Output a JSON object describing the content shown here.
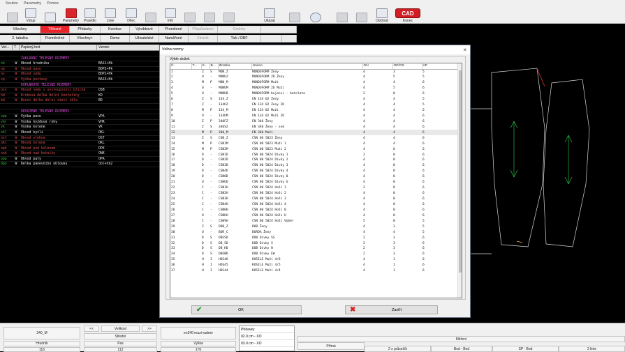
{
  "menu": [
    "Soubor",
    "Parametry",
    "Pomoc"
  ],
  "toolbar": [
    {
      "label": "",
      "icon": "grid-icon"
    },
    {
      "label": "Vstup",
      "icon": "input-icon"
    },
    {
      "label": "",
      "icon": "pattern-icon"
    },
    {
      "label": "Parametry",
      "icon": "parameters-icon"
    },
    {
      "label": "Pravidlo",
      "icon": "rule-icon"
    },
    {
      "label": "Linie",
      "icon": "line-icon"
    },
    {
      "label": "Dílec",
      "icon": "piece-icon"
    },
    {
      "label": "",
      "icon": "piece2-icon"
    },
    {
      "label": "Info",
      "icon": "printer-icon"
    },
    {
      "label": "",
      "icon": "screen-icon"
    },
    {
      "label": "",
      "icon": "document-icon"
    },
    {
      "label": "",
      "icon": "document2-icon"
    },
    {
      "label": "Ukázat",
      "icon": "show-icon"
    },
    {
      "label": "",
      "icon": "hand-icon"
    },
    {
      "label": "",
      "icon": "back-icon"
    },
    {
      "label": "",
      "icon": "save-icon"
    },
    {
      "label": "",
      "icon": "save-as-icon"
    },
    {
      "label": "Odchod",
      "icon": "exit-icon"
    },
    {
      "label": "Konec",
      "icon": "cad-logo-icon"
    }
  ],
  "tabs_row1": [
    "Všechny",
    "Tělesné",
    "Přídavky",
    "Korekce",
    "Výrobkové",
    "Proměnné",
    "Přizpůsobení",
    "Ozdoby",
    ""
  ],
  "tabs_row2": [
    "2. tabulka",
    "Pozměněné",
    "Všechny+",
    "Demo",
    "Uživatelské",
    "Naměřené",
    "Závislé",
    "Tisk / DBF",
    "",
    ""
  ],
  "attr_header": [
    "Vel...",
    "T",
    "Popisný text",
    "Vzorec"
  ],
  "attributes": [
    {
      "code": "",
      "t": "",
      "text": "",
      "formula": "",
      "style": "normal"
    },
    {
      "code": "",
      "t": "",
      "text": "ZÁKLADNÍ TĚLESNÉ ROZMĚRY",
      "formula": "",
      "style": "sec"
    },
    {
      "code": "oh",
      "t": "W",
      "text": "Obvod hrudníku",
      "formula": "BAS1+Hk",
      "style": "grn"
    },
    {
      "code": "op",
      "t": "W",
      "text": "Obvod pasu",
      "formula": "BOP2+Pk",
      "style": "red"
    },
    {
      "code": "os",
      "t": "W",
      "text": "Obvod sedu",
      "formula": "BOP2+Hk",
      "style": "red"
    },
    {
      "code": "vp",
      "t": "W",
      "text": "Výška postavy",
      "formula": "BAS3+Hk",
      "style": "red"
    },
    {
      "code": "",
      "t": "",
      "text": "DOPLŇKOVÉ TĚLESNÉ ROZMĚRY",
      "formula": "",
      "style": "sec"
    },
    {
      "code": "osv",
      "t": "W",
      "text": "Obvod sedu s vystouplostí břicha",
      "formula": "OSB",
      "style": "red"
    },
    {
      "code": "hd",
      "t": "W",
      "text": "Kroková délka dolní končetiny",
      "formula": "KD",
      "style": "red"
    },
    {
      "code": "bd",
      "t": "W",
      "text": "Boční délka dolní části těla",
      "formula": "BD",
      "style": "red"
    },
    {
      "code": "",
      "t": "",
      "text": "",
      "formula": "",
      "style": "normal"
    },
    {
      "code": "",
      "t": "",
      "text": "ODVOZENÉ TĚLESNÉ ROZMĚRY",
      "formula": "",
      "style": "sec"
    },
    {
      "code": "vpa",
      "t": "W",
      "text": "Výška pasu",
      "formula": "VPA",
      "style": "grn"
    },
    {
      "code": "vhr",
      "t": "W",
      "text": "Výška hýžďové rýhy",
      "formula": "VHR",
      "style": "grn"
    },
    {
      "code": "vk",
      "t": "W",
      "text": "Výška kolene",
      "formula": "VK",
      "style": "grn"
    },
    {
      "code": "okl",
      "t": "W",
      "text": "Obvod kyčlí",
      "formula": "OKL",
      "style": "grn"
    },
    {
      "code": "ost",
      "t": "W",
      "text": "Obvod stehna",
      "formula": "OST",
      "style": "red"
    },
    {
      "code": "okl",
      "t": "W",
      "text": "Obvod kolene",
      "formula": "OKL",
      "style": "red"
    },
    {
      "code": "opk",
      "t": "W",
      "text": "Obvod pod kolenem",
      "formula": "OPK",
      "style": "red"
    },
    {
      "code": "onk",
      "t": "W",
      "text": "Obvod nad kotníky",
      "formula": "ONK",
      "style": "red"
    },
    {
      "code": "opa",
      "t": "W",
      "text": "Obvod paty",
      "formula": "OPA",
      "style": "grn"
    },
    {
      "code": "dpo",
      "t": "W",
      "text": "Délka pánevního oblouku",
      "formula": "obl+hb2",
      "style": "grn"
    }
  ],
  "dialog": {
    "title": "Volba normy",
    "group_label": "Výběr složek",
    "columns": [
      "Č.",
      "T...",
      "S...",
      "B...",
      "Zkratka",
      "Jméno",
      "OH",
      "OP/OS",
      "VP"
    ],
    "rows": [
      [
        "1",
        "",
        "Z",
        "S",
        "MON_Z",
        "MONDOFORM Ženy",
        "4",
        "3",
        "5"
      ],
      [
        "2",
        "",
        "U",
        "-",
        "MONUZ",
        "MONDOFORM 2D Ženy",
        "4",
        "5",
        "5"
      ],
      [
        "3",
        "",
        "M",
        "P",
        "MON_M",
        "MONDOFORM Muži",
        "4",
        "4",
        "6"
      ],
      [
        "4",
        "",
        "U",
        "-",
        "MONUM",
        "MONDOFORM 2D Muži",
        "4",
        "5",
        "6"
      ],
      [
        "5",
        "",
        "U",
        "-",
        "MONUB",
        "MONDOFORM bojenci - batolata",
        "2",
        "0",
        "6"
      ],
      [
        "6",
        "",
        "Z",
        "S",
        "134_Z",
        "EN 134 02 Ženy",
        "4",
        "4",
        "5"
      ],
      [
        "7",
        "",
        "Z",
        "-",
        "134UZ",
        "EN 134 02 Ženy 2D",
        "4",
        "4",
        "5"
      ],
      [
        "8",
        "",
        "M",
        "P",
        "134_M",
        "EN 134 02 Muži",
        "4",
        "4",
        "6"
      ],
      [
        "9",
        "",
        "U",
        "-",
        "134UM",
        "EN 134 02 Muži 2D",
        "4",
        "4",
        "6"
      ],
      [
        "10",
        "",
        "Z",
        "P",
        "340FZ",
        "EN 340 Ženy",
        "4",
        "4",
        "6"
      ],
      [
        "11",
        "",
        "Z",
        "S",
        "340SZ",
        "EN 340 Ženy - sed",
        "4",
        "4",
        "6"
      ],
      [
        "12",
        "",
        "M",
        "P",
        "340_M",
        "EN 340 Muži",
        "4",
        "4",
        "6"
      ],
      [
        "13",
        "",
        "Z",
        "S",
        "CSN_Z",
        "ČSN 80 5023 Ženy",
        "4",
        "4",
        "6"
      ],
      [
        "14",
        "",
        "M",
        "P",
        "CSN1M",
        "ČSN 80 5023 Muži 1",
        "4",
        "4",
        "6"
      ],
      [
        "15",
        "",
        "M",
        "P",
        "CSN2M",
        "ČSN 80 5023 Muži 2",
        "4",
        "6",
        "6"
      ],
      [
        "16",
        "",
        "D",
        "-",
        "CSN1D",
        "ČSN 80 5024 Dívky 1",
        "2",
        "0",
        "6"
      ],
      [
        "17",
        "",
        "D",
        "-",
        "CSN2D",
        "ČSN 80 5024 Dívky 2",
        "4",
        "0",
        "6"
      ],
      [
        "18",
        "",
        "D",
        "-",
        "CSN3D",
        "ČSN 80 5024 Dívky 3",
        "4",
        "0",
        "6"
      ],
      [
        "19",
        "",
        "D",
        "-",
        "CSN4D",
        "ČSN 80 5024 Dívky 4",
        "4",
        "0",
        "6"
      ],
      [
        "20",
        "",
        "D",
        "-",
        "CSN0D",
        "ČSN 80 5024 Dívky 0",
        "4",
        "0",
        "6"
      ],
      [
        "21",
        "",
        "U",
        "-",
        "CSNUD",
        "ČSN 80 5024 Dívky U",
        "4",
        "0",
        "6"
      ],
      [
        "22",
        "",
        "C",
        "-",
        "CSN1H",
        "ČSN 80 5024 Hoši 1",
        "2",
        "0",
        "6"
      ],
      [
        "23",
        "",
        "C",
        "-",
        "CSN2H",
        "ČSN 80 5024 Hoši 2",
        "4",
        "0",
        "6"
      ],
      [
        "24",
        "",
        "C",
        "-",
        "CSN3H",
        "ČSN 80 5024 Hoši 3",
        "4",
        "0",
        "6"
      ],
      [
        "25",
        "",
        "C",
        "-",
        "CSN4H",
        "ČSN 80 5024 Hoši 4",
        "4",
        "0",
        "6"
      ],
      [
        "26",
        "",
        "C",
        "-",
        "CSN0H",
        "ČSN 80 5024 Hoši 0",
        "4",
        "0",
        "6"
      ],
      [
        "27",
        "",
        "U",
        "-",
        "CSNUH",
        "ČSN 80 5024 Hoši U",
        "4",
        "0",
        "6"
      ],
      [
        "28",
        "",
        "C",
        "-",
        "CSNVH",
        "ČSN 80 5024 Hoši Výběr",
        "5",
        "0",
        "5"
      ],
      [
        "29",
        "",
        "Z",
        "S",
        "DOB_Z",
        "DOB Ženy",
        "4",
        "3",
        "5"
      ],
      [
        "30",
        "",
        "U",
        "-",
        "BUR_C",
        "BURDA Ženy",
        "4",
        "4",
        "5"
      ],
      [
        "31",
        "",
        "D",
        "S",
        "DBSSD",
        "DOB Dívky SS",
        "2",
        "3",
        "6"
      ],
      [
        "32",
        "",
        "D",
        "S",
        "DB_SD",
        "DOB Dívky S",
        "2",
        "3",
        "6"
      ],
      [
        "33",
        "",
        "D",
        "S",
        "DB_HD",
        "DOB Dívky H",
        "2",
        "3",
        "6"
      ],
      [
        "34",
        "",
        "D",
        "S",
        "DBEWD",
        "DOB Dívky EW",
        "2",
        "3",
        "6"
      ],
      [
        "35",
        "",
        "H",
        "I",
        "HOS46",
        "KOŠILE Muži 4/6",
        "4",
        "1",
        "6"
      ],
      [
        "36",
        "",
        "H",
        "I",
        "HOS45",
        "KOŠILE Muži 4/5",
        "4",
        "1",
        "6"
      ],
      [
        "37",
        "",
        "H",
        "I",
        "HOS44",
        "KOŠILE Muži 4/4",
        "4",
        "1",
        "6"
      ]
    ],
    "ok_label": "OK",
    "cancel_label": "Zavřít",
    "close_glyph": "×"
  },
  "bottom": {
    "prev": "<<",
    "size_label": "Velikost",
    "next": ">>",
    "size_value": "340_M",
    "size_mid": "Střední",
    "norm": "en340 muzi-radner",
    "col1": "Hrudník",
    "col2": "Pas",
    "col3": "Výška",
    "v1": "116",
    "v2": "112",
    "v3": "176",
    "pridavky_title": "Přídavky",
    "pridavky_items": [
      "02.0 cm - XO",
      "03.0 cm - XO"
    ],
    "mereni": "Měření",
    "prima": "Přímá",
    "m1": "2 x průsečík",
    "m2": "Bod - Bod",
    "m3": "SP - Bod",
    "m4": "2 linie"
  }
}
